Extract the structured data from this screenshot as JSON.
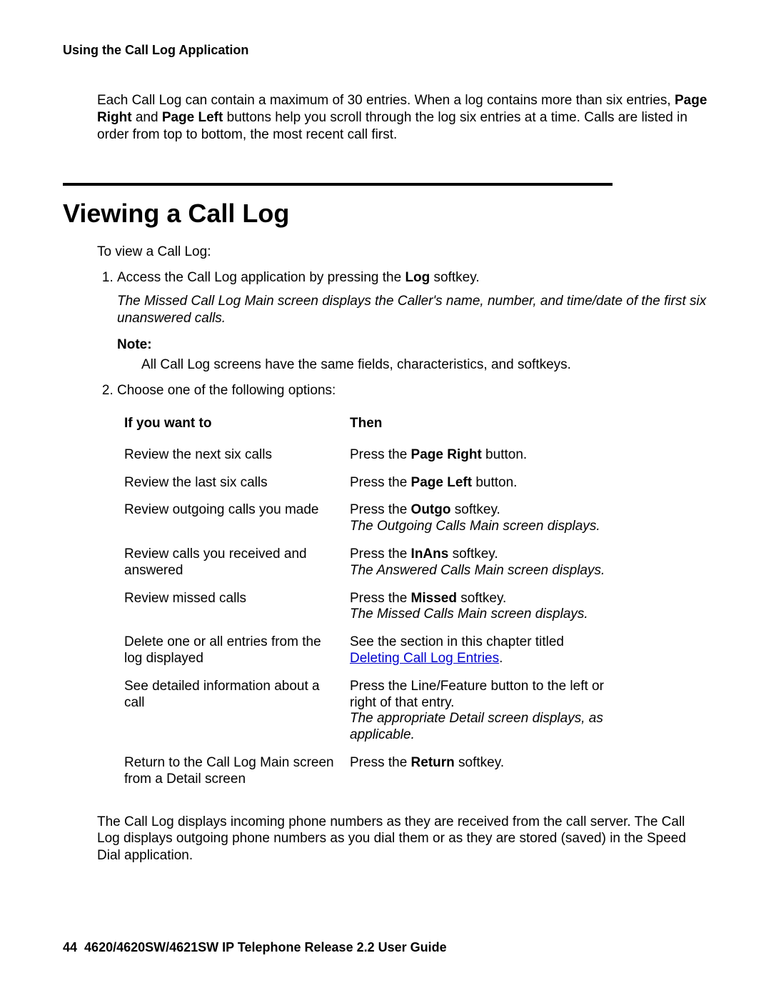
{
  "header": {
    "running_head": "Using the Call Log Application"
  },
  "intro": {
    "p1_a": "Each Call Log can contain a maximum of 30 entries. When a log contains more than six entries, ",
    "p1_b": "Page Right",
    "p1_c": " and ",
    "p1_d": "Page Left",
    "p1_e": " buttons help you scroll through the log six entries at a time. Calls are listed in order from top to bottom, the most recent call first."
  },
  "section": {
    "title": "Viewing a Call Log",
    "lead": "To view a Call Log:"
  },
  "step1": {
    "a": "Access the Call Log application by pressing the ",
    "b": "Log",
    "c": " softkey.",
    "sub": "The Missed Call Log Main screen displays the Caller's name, number, and time/date of the first six unanswered calls.",
    "note_label": "Note:",
    "note_body": "All Call Log screens have the same fields, characteristics, and softkeys."
  },
  "step2": {
    "text": "Choose one of the following options:"
  },
  "table": {
    "h1": "If you want to",
    "h2": "Then",
    "rows": [
      {
        "left": "Review the next six calls",
        "right_a": "Press the ",
        "right_b": "Page Right",
        "right_c": " button."
      },
      {
        "left": "Review the last six calls",
        "right_a": "Press the ",
        "right_b": "Page Left",
        "right_c": " button."
      },
      {
        "left": "Review outgoing calls you made",
        "right_a": "Press the ",
        "right_b": "Outgo",
        "right_c": " softkey.",
        "right_ital": "The Outgoing Calls Main screen displays."
      },
      {
        "left": "Review calls you received and answered",
        "right_a": "Press the ",
        "right_b": "InAns",
        "right_c": " softkey.",
        "right_ital": "The Answered Calls Main screen displays."
      },
      {
        "left": "Review missed calls",
        "right_a": "Press the ",
        "right_b": "Missed",
        "right_c": " softkey.",
        "right_ital": "The Missed Calls Main screen displays."
      },
      {
        "left": "Delete one or all entries from the log displayed",
        "right_a": "See the section in this chapter titled ",
        "right_link": "Deleting Call Log Entries",
        "right_c": "."
      },
      {
        "left": "See detailed information about a call",
        "right_a": "Press the Line/Feature button to the left or right of that entry.",
        "right_ital": "The appropriate Detail screen displays, as applicable."
      },
      {
        "left": "Return to the Call Log Main screen from a Detail screen",
        "right_a": "Press the ",
        "right_b": "Return",
        "right_c": " softkey."
      }
    ]
  },
  "closing": {
    "text": "The Call Log displays incoming phone numbers as they are received from the call server. The Call Log displays outgoing phone numbers as you dial them or as they are stored (saved) in the Speed Dial application."
  },
  "footer": {
    "page_num": "44",
    "doc_title": "4620/4620SW/4621SW IP Telephone Release 2.2 User Guide"
  }
}
